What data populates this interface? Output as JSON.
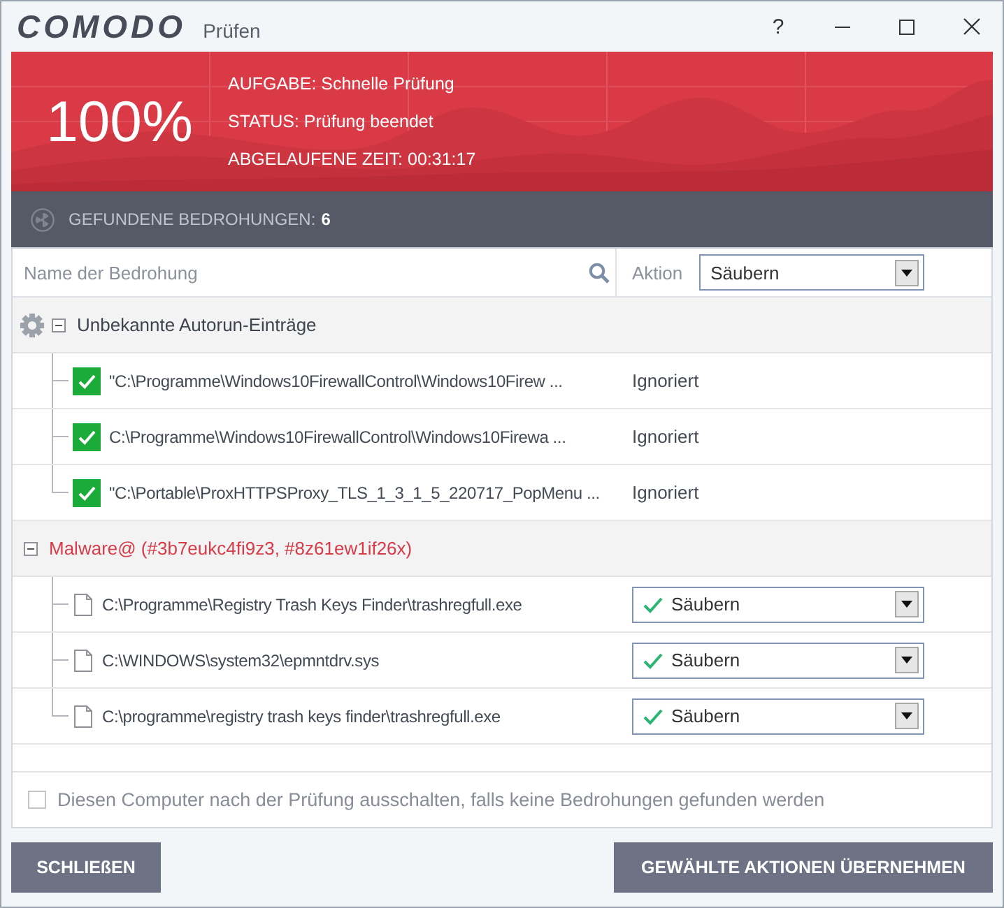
{
  "window": {
    "logo": "COMODO",
    "title": "Prüfen",
    "help": "?"
  },
  "scan": {
    "progress": "100%",
    "details": [
      "AUFGABE: Schnelle Prüfung",
      "STATUS: Prüfung beendet",
      "ABGELAUFENE ZEIT: 00:31:17"
    ]
  },
  "threats_bar": {
    "label": "GEFUNDENE BEDROHUNGEN:",
    "count": "6"
  },
  "filter": {
    "placeholder": "Name der Bedrohung",
    "action_label": "Aktion",
    "action_value": "Säubern"
  },
  "groups": [
    {
      "kind": "autorun",
      "name": "Unbekannte Autorun-Einträge",
      "expanded": true,
      "items": [
        {
          "kind": "checkbox",
          "checked": true,
          "path": "\"C:\\Programme\\Windows10FirewallControl\\Windows10Firew ...",
          "action": "Ignoriert"
        },
        {
          "kind": "checkbox",
          "checked": true,
          "path": "C:\\Programme\\Windows10FirewallControl\\Windows10Firewa ...",
          "action": "Ignoriert"
        },
        {
          "kind": "checkbox",
          "checked": true,
          "path": "\"C:\\Portable\\ProxHTTPSProxy_TLS_1_3_1_5_220717_PopMenu ...",
          "action": "Ignoriert"
        }
      ]
    },
    {
      "kind": "malware",
      "name": "Malware@ (#3b7eukc4fi9z3, #8z61ew1if26x)",
      "expanded": true,
      "items": [
        {
          "kind": "dropdown",
          "path": "C:\\Programme\\Registry Trash Keys Finder\\trashregfull.exe",
          "action": "Säubern"
        },
        {
          "kind": "dropdown",
          "path": "C:\\WINDOWS\\system32\\epmntdrv.sys",
          "action": "Säubern"
        },
        {
          "kind": "dropdown",
          "path": "C:\\programme\\registry trash keys finder\\trashregfull.exe",
          "action": "Säubern"
        }
      ]
    }
  ],
  "shutdown_option": {
    "label": "Diesen Computer nach der Prüfung ausschalten, falls keine Bedrohungen gefunden werden",
    "checked": false
  },
  "buttons": [
    "SCHLIEßEN",
    "GEWÄHLTE AKTIONEN ÜBERNEHMEN"
  ]
}
